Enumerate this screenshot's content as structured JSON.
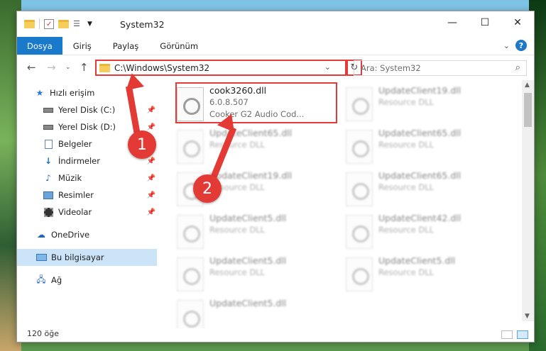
{
  "window": {
    "title": "System32"
  },
  "ribbon": {
    "tabs": [
      "Dosya",
      "Giriş",
      "Paylaş",
      "Görünüm"
    ],
    "help": "?"
  },
  "nav": {
    "address": "C:\\Windows\\System32",
    "search_placeholder": "Ara: System32"
  },
  "sidebar": {
    "items": [
      {
        "label": "Hızlı erişim",
        "icon": "star-icon",
        "pinned": false
      },
      {
        "label": "Yerel Disk (C:)",
        "icon": "drive-icon",
        "pinned": true
      },
      {
        "label": "Yerel Disk (D:)",
        "icon": "drive-icon",
        "pinned": true
      },
      {
        "label": "Belgeler",
        "icon": "documents-icon",
        "pinned": true
      },
      {
        "label": "İndirmeler",
        "icon": "download-icon",
        "pinned": true
      },
      {
        "label": "Müzik",
        "icon": "music-icon",
        "pinned": true
      },
      {
        "label": "Resimler",
        "icon": "pictures-icon",
        "pinned": true
      },
      {
        "label": "Videolar",
        "icon": "video-icon",
        "pinned": true
      },
      {
        "label": "OneDrive",
        "icon": "cloud-icon",
        "pinned": false
      },
      {
        "label": "Bu bilgisayar",
        "icon": "computer-icon",
        "pinned": false,
        "selected": true
      },
      {
        "label": "Ağ",
        "icon": "network-icon",
        "pinned": false
      }
    ]
  },
  "files": {
    "highlighted": {
      "name": "cook3260.dll",
      "version": "6.0.8.507",
      "description": "Cooker G2 Audio Cod..."
    },
    "background": [
      {
        "name": "UpdateClient19.dll",
        "type": "Resource DLL"
      },
      {
        "name": "UpdateClient65.dll",
        "type": "Resource DLL"
      },
      {
        "name": "UpdateClient65.dll",
        "type": "Resource DLL"
      },
      {
        "name": "UpdateClient19.dll",
        "type": "Resource DLL"
      },
      {
        "name": "UpdateClient65.dll",
        "type": "Resource DLL"
      },
      {
        "name": "UpdateClient5.dll",
        "type": "Resource DLL"
      },
      {
        "name": "UpdateClient42.dll",
        "type": "Resource DLL"
      },
      {
        "name": "UpdateClient5.dll",
        "type": "Resource DLL"
      },
      {
        "name": "UpdateClient5.dll",
        "type": "Resource DLL"
      },
      {
        "name": "UpdateClient5.dll",
        "type": "Resource DLL"
      }
    ]
  },
  "status": {
    "count": "120 öğe"
  },
  "annotations": {
    "step1": "1",
    "step2": "2",
    "color": "#e33a36"
  }
}
